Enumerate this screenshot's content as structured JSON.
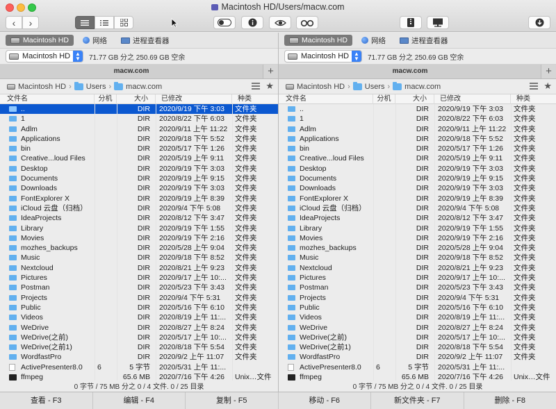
{
  "window": {
    "title": "Macintosh HD/Users/macw.com"
  },
  "drives": [
    {
      "label": "Macintosh HD",
      "icon": "hard-drive-icon",
      "selected": true
    },
    {
      "label": "网络",
      "icon": "network-globe-icon",
      "selected": false
    },
    {
      "label": "进程查看器",
      "icon": "process-viewer-icon",
      "selected": false
    }
  ],
  "volume": {
    "selected": "Macintosh HD",
    "free_space": "71.77 GB 分之 250.69 GB 空余"
  },
  "tab": {
    "label": "macw.com"
  },
  "path": [
    "Macintosh HD",
    "Users",
    "macw.com"
  ],
  "columns": {
    "name": "文件名",
    "ext": "分机",
    "size": "大小",
    "date": "已修改",
    "kind": "种类"
  },
  "left_rows": [
    {
      "name": "..",
      "ext": "",
      "size": "DIR",
      "date": "2020/9/19 下午 3:03",
      "kind": "文件夹",
      "icon": "folder"
    },
    {
      "name": "1",
      "ext": "",
      "size": "DIR",
      "date": "2020/8/22 下午 6:03",
      "kind": "文件夹",
      "icon": "folder"
    },
    {
      "name": "Adlm",
      "ext": "",
      "size": "DIR",
      "date": "2020/9/11 上午 11:22",
      "kind": "文件夹",
      "icon": "folder"
    },
    {
      "name": "Applications",
      "ext": "",
      "size": "DIR",
      "date": "2020/9/18 下午 5:52",
      "kind": "文件夹",
      "icon": "folder"
    },
    {
      "name": "bin",
      "ext": "",
      "size": "DIR",
      "date": "2020/5/17 下午 1:26",
      "kind": "文件夹",
      "icon": "folder"
    },
    {
      "name": "Creative...loud Files",
      "ext": "",
      "size": "DIR",
      "date": "2020/5/19 上午 9:11",
      "kind": "文件夹",
      "icon": "folder"
    },
    {
      "name": "Desktop",
      "ext": "",
      "size": "DIR",
      "date": "2020/9/19 下午 3:03",
      "kind": "文件夹",
      "icon": "folder"
    },
    {
      "name": "Documents",
      "ext": "",
      "size": "DIR",
      "date": "2020/9/19 上午 9:15",
      "kind": "文件夹",
      "icon": "folder"
    },
    {
      "name": "Downloads",
      "ext": "",
      "size": "DIR",
      "date": "2020/9/19 下午 3:03",
      "kind": "文件夹",
      "icon": "folder"
    },
    {
      "name": "FontExplorer X",
      "ext": "",
      "size": "DIR",
      "date": "2020/9/19 上午 8:39",
      "kind": "文件夹",
      "icon": "folder"
    },
    {
      "name": "iCloud 云盘（归档）",
      "ext": "",
      "size": "DIR",
      "date": "2020/9/4 下午 5:08",
      "kind": "文件夹",
      "icon": "folder"
    },
    {
      "name": "IdeaProjects",
      "ext": "",
      "size": "DIR",
      "date": "2020/8/12 下午 3:47",
      "kind": "文件夹",
      "icon": "folder"
    },
    {
      "name": "Library",
      "ext": "",
      "size": "DIR",
      "date": "2020/9/19 下午 1:55",
      "kind": "文件夹",
      "icon": "folder"
    },
    {
      "name": "Movies",
      "ext": "",
      "size": "DIR",
      "date": "2020/9/19 下午 2:16",
      "kind": "文件夹",
      "icon": "folder"
    },
    {
      "name": "mozhes_backups",
      "ext": "",
      "size": "DIR",
      "date": "2020/5/28 上午 9:04",
      "kind": "文件夹",
      "icon": "folder"
    },
    {
      "name": "Music",
      "ext": "",
      "size": "DIR",
      "date": "2020/9/18 下午 8:52",
      "kind": "文件夹",
      "icon": "folder"
    },
    {
      "name": "Nextcloud",
      "ext": "",
      "size": "DIR",
      "date": "2020/8/21 上午 9:23",
      "kind": "文件夹",
      "icon": "folder"
    },
    {
      "name": "Pictures",
      "ext": "",
      "size": "DIR",
      "date": "2020/9/17 上午 10:...",
      "kind": "文件夹",
      "icon": "folder"
    },
    {
      "name": "Postman",
      "ext": "",
      "size": "DIR",
      "date": "2020/5/23 下午 3:43",
      "kind": "文件夹",
      "icon": "folder"
    },
    {
      "name": "Projects",
      "ext": "",
      "size": "DIR",
      "date": "2020/9/4 下午 5:31",
      "kind": "文件夹",
      "icon": "folder"
    },
    {
      "name": "Public",
      "ext": "",
      "size": "DIR",
      "date": "2020/5/16 下午 6:10",
      "kind": "文件夹",
      "icon": "folder"
    },
    {
      "name": "Videos",
      "ext": "",
      "size": "DIR",
      "date": "2020/8/19 上午 11:...",
      "kind": "文件夹",
      "icon": "folder"
    },
    {
      "name": "WeDrive",
      "ext": "",
      "size": "DIR",
      "date": "2020/8/27 上午 8:24",
      "kind": "文件夹",
      "icon": "folder"
    },
    {
      "name": "WeDrive(之前)",
      "ext": "",
      "size": "DIR",
      "date": "2020/5/17 上午 10:...",
      "kind": "文件夹",
      "icon": "folder"
    },
    {
      "name": "WeDrive(之前1)",
      "ext": "",
      "size": "DIR",
      "date": "2020/8/18 下午 5:54",
      "kind": "文件夹",
      "icon": "folder"
    },
    {
      "name": "WordfastPro",
      "ext": "",
      "size": "DIR",
      "date": "2020/9/2 上午 11:07",
      "kind": "文件夹",
      "icon": "folder"
    },
    {
      "name": "ActivePresenter8.0",
      "ext": "6",
      "size": "5 字节",
      "date": "2020/5/31 上午 11:...",
      "kind": "",
      "icon": "document"
    },
    {
      "name": "ffmpeg",
      "ext": "",
      "size": "65.6 MB",
      "date": "2020/7/16 下午 4:26",
      "kind": "Unix…文件",
      "icon": "executable"
    }
  ],
  "right_rows": [
    {
      "name": "..",
      "ext": "",
      "size": "DIR",
      "date": "2020/9/19 下午 3:03",
      "kind": "文件夹",
      "icon": "folder"
    },
    {
      "name": "1",
      "ext": "",
      "size": "DIR",
      "date": "2020/8/22 下午 6:03",
      "kind": "文件夹",
      "icon": "folder"
    },
    {
      "name": "Adlm",
      "ext": "",
      "size": "DIR",
      "date": "2020/9/11 上午 11:22",
      "kind": "文件夹",
      "icon": "folder"
    },
    {
      "name": "Applications",
      "ext": "",
      "size": "DIR",
      "date": "2020/9/18 下午 5:52",
      "kind": "文件夹",
      "icon": "folder"
    },
    {
      "name": "bin",
      "ext": "",
      "size": "DIR",
      "date": "2020/5/17 下午 1:26",
      "kind": "文件夹",
      "icon": "folder"
    },
    {
      "name": "Creative...loud Files",
      "ext": "",
      "size": "DIR",
      "date": "2020/5/19 上午 9:11",
      "kind": "文件夹",
      "icon": "folder"
    },
    {
      "name": "Desktop",
      "ext": "",
      "size": "DIR",
      "date": "2020/9/19 下午 3:03",
      "kind": "文件夹",
      "icon": "folder"
    },
    {
      "name": "Documents",
      "ext": "",
      "size": "DIR",
      "date": "2020/9/19 上午 9:15",
      "kind": "文件夹",
      "icon": "folder"
    },
    {
      "name": "Downloads",
      "ext": "",
      "size": "DIR",
      "date": "2020/9/19 下午 3:03",
      "kind": "文件夹",
      "icon": "folder"
    },
    {
      "name": "FontExplorer X",
      "ext": "",
      "size": "DIR",
      "date": "2020/9/19 上午 8:39",
      "kind": "文件夹",
      "icon": "folder"
    },
    {
      "name": "iCloud 云盘（归档）",
      "ext": "",
      "size": "DIR",
      "date": "2020/9/4 下午 5:08",
      "kind": "文件夹",
      "icon": "folder"
    },
    {
      "name": "IdeaProjects",
      "ext": "",
      "size": "DIR",
      "date": "2020/8/12 下午 3:47",
      "kind": "文件夹",
      "icon": "folder"
    },
    {
      "name": "Library",
      "ext": "",
      "size": "DIR",
      "date": "2020/9/19 下午 1:55",
      "kind": "文件夹",
      "icon": "folder"
    },
    {
      "name": "Movies",
      "ext": "",
      "size": "DIR",
      "date": "2020/9/19 下午 2:16",
      "kind": "文件夹",
      "icon": "folder"
    },
    {
      "name": "mozhes_backups",
      "ext": "",
      "size": "DIR",
      "date": "2020/5/28 上午 9:04",
      "kind": "文件夹",
      "icon": "folder"
    },
    {
      "name": "Music",
      "ext": "",
      "size": "DIR",
      "date": "2020/9/18 下午 8:52",
      "kind": "文件夹",
      "icon": "folder"
    },
    {
      "name": "Nextcloud",
      "ext": "",
      "size": "DIR",
      "date": "2020/8/21 上午 9:23",
      "kind": "文件夹",
      "icon": "folder"
    },
    {
      "name": "Pictures",
      "ext": "",
      "size": "DIR",
      "date": "2020/9/17 上午 10:...",
      "kind": "文件夹",
      "icon": "folder"
    },
    {
      "name": "Postman",
      "ext": "",
      "size": "DIR",
      "date": "2020/5/23 下午 3:43",
      "kind": "文件夹",
      "icon": "folder"
    },
    {
      "name": "Projects",
      "ext": "",
      "size": "DIR",
      "date": "2020/9/4 下午 5:31",
      "kind": "文件夹",
      "icon": "folder"
    },
    {
      "name": "Public",
      "ext": "",
      "size": "DIR",
      "date": "2020/5/16 下午 6:10",
      "kind": "文件夹",
      "icon": "folder"
    },
    {
      "name": "Videos",
      "ext": "",
      "size": "DIR",
      "date": "2020/8/19 上午 11:...",
      "kind": "文件夹",
      "icon": "folder"
    },
    {
      "name": "WeDrive",
      "ext": "",
      "size": "DIR",
      "date": "2020/8/27 上午 8:24",
      "kind": "文件夹",
      "icon": "folder"
    },
    {
      "name": "WeDrive(之前)",
      "ext": "",
      "size": "DIR",
      "date": "2020/5/17 上午 10:...",
      "kind": "文件夹",
      "icon": "folder"
    },
    {
      "name": "WeDrive(之前1)",
      "ext": "",
      "size": "DIR",
      "date": "2020/8/18 下午 5:54",
      "kind": "文件夹",
      "icon": "folder"
    },
    {
      "name": "WordfastPro",
      "ext": "",
      "size": "DIR",
      "date": "2020/9/2 上午 11:07",
      "kind": "文件夹",
      "icon": "folder"
    },
    {
      "name": "ActivePresenter8.0",
      "ext": "6",
      "size": "5 字节",
      "date": "2020/5/31 上午 11:...",
      "kind": "",
      "icon": "document"
    },
    {
      "name": "ffmpeg",
      "ext": "",
      "size": "65.6 MB",
      "date": "2020/7/16 下午 4:26",
      "kind": "Unix…文件",
      "icon": "executable"
    }
  ],
  "selected_row": 0,
  "status": "0 字节 / 75 MB 分之 0 / 4 文件. 0 / 25 目录",
  "fkeys": [
    "查看 - F3",
    "编辑 - F4",
    "复制 - F5",
    "移动 - F6",
    "新文件夹 - F7",
    "删除 - F8"
  ],
  "colors": {
    "selection": "#0b58d0",
    "folder": "#62b0ef",
    "accent": "#3a82f7"
  }
}
